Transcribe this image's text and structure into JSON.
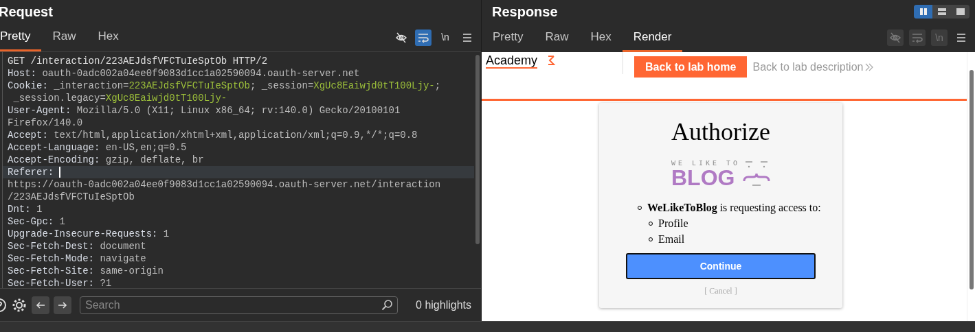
{
  "request": {
    "title": "Request",
    "tabs": [
      {
        "label": "Pretty",
        "selected": true
      },
      {
        "label": "Raw",
        "selected": false
      },
      {
        "label": "Hex",
        "selected": false
      }
    ],
    "toolbar": [
      {
        "kind": "eye",
        "active": false,
        "disabled": false
      },
      {
        "kind": "wrap",
        "active": true,
        "disabled": false
      },
      {
        "kind": "newline",
        "label": "\\n",
        "active": false,
        "disabled": false
      },
      {
        "kind": "menu",
        "active": false,
        "disabled": false
      }
    ],
    "lines": [
      [
        {
          "kind": "plain",
          "text": "GET /interaction/223AEJdsfVFCTuIeSptOb HTTP/2"
        }
      ],
      [
        {
          "kind": "name",
          "text": "Host:"
        },
        {
          "kind": "value",
          "text": " oauth-0adc002a04ee0f9083d1cc1a02590094.oauth-server.net"
        }
      ],
      [
        {
          "kind": "name",
          "text": "Cookie:"
        },
        {
          "kind": "value",
          "text": " _interaction="
        },
        {
          "kind": "cookie",
          "text": "223AEJdsfVFCTuIeSptOb"
        },
        {
          "kind": "value",
          "text": "; _session="
        },
        {
          "kind": "cookie",
          "text": "XgUc8Eaiwjd0tT100Ljy-"
        },
        {
          "kind": "value",
          "text": ";"
        }
      ],
      [
        {
          "kind": "value",
          "text": " _session.legacy="
        },
        {
          "kind": "cookie",
          "text": "XgUc8Eaiwjd0tT100Ljy-"
        }
      ],
      [
        {
          "kind": "name",
          "text": "User-Agent:"
        },
        {
          "kind": "value",
          "text": " Mozilla/5.0 (X11; Linux x86_64; rv:140.0) Gecko/20100101"
        }
      ],
      [
        {
          "kind": "value",
          "text": "Firefox/140.0"
        }
      ],
      [
        {
          "kind": "name",
          "text": "Accept:"
        },
        {
          "kind": "value",
          "text": " text/html,application/xhtml+xml,application/xml;q=0.9,*/*;q=0.8"
        }
      ],
      [
        {
          "kind": "name",
          "text": "Accept-Language:"
        },
        {
          "kind": "value",
          "text": " en-US,en;q=0.5"
        }
      ],
      [
        {
          "kind": "name",
          "text": "Accept-Encoding:"
        },
        {
          "kind": "value",
          "text": " gzip, deflate, br"
        }
      ],
      [
        {
          "kind": "name",
          "text": "Referer:"
        },
        {
          "kind": "cursor"
        }
      ],
      [
        {
          "kind": "value",
          "text": "https://oauth-0adc002a04ee0f9083d1cc1a02590094.oauth-server.net/interaction"
        }
      ],
      [
        {
          "kind": "value",
          "text": "/223AEJdsfVFCTuIeSptOb"
        }
      ],
      [
        {
          "kind": "name",
          "text": "Dnt:"
        },
        {
          "kind": "value",
          "text": " 1"
        }
      ],
      [
        {
          "kind": "name",
          "text": "Sec-Gpc:"
        },
        {
          "kind": "value",
          "text": " 1"
        }
      ],
      [
        {
          "kind": "name",
          "text": "Upgrade-Insecure-Requests:"
        },
        {
          "kind": "value",
          "text": " 1"
        }
      ],
      [
        {
          "kind": "name",
          "text": "Sec-Fetch-Dest:"
        },
        {
          "kind": "value",
          "text": " document"
        }
      ],
      [
        {
          "kind": "name",
          "text": "Sec-Fetch-Mode:"
        },
        {
          "kind": "value",
          "text": " navigate"
        }
      ],
      [
        {
          "kind": "name",
          "text": "Sec-Fetch-Site:"
        },
        {
          "kind": "value",
          "text": " same-origin"
        }
      ],
      [
        {
          "kind": "name",
          "text": "Sec-Fetch-User:"
        },
        {
          "kind": "value",
          "text": " ?1"
        }
      ]
    ],
    "search": {
      "placeholder": "Search"
    },
    "highlights": "0 highlights"
  },
  "response": {
    "title": "Response",
    "layout_buttons": [
      {
        "kind": "columns",
        "selected": true
      },
      {
        "kind": "rows",
        "selected": false
      },
      {
        "kind": "single",
        "selected": false
      }
    ],
    "tabs": [
      {
        "label": "Pretty",
        "selected": false
      },
      {
        "label": "Raw",
        "selected": false
      },
      {
        "label": "Hex",
        "selected": false
      },
      {
        "label": "Render",
        "selected": true
      }
    ],
    "toolbar": [
      {
        "kind": "eye",
        "active": false,
        "disabled": true
      },
      {
        "kind": "wrap",
        "active": false,
        "disabled": true
      },
      {
        "kind": "newline",
        "label": "\\n",
        "active": false,
        "disabled": true
      },
      {
        "kind": "menu",
        "active": false,
        "disabled": false
      }
    ],
    "render": {
      "logo_text": "Academy",
      "home_button": "Back to lab home",
      "description_link": "Back to lab description",
      "card": {
        "title": "Authorize",
        "logo_small": "WE LIKE TO",
        "logo_big": "BLOG",
        "request_text": "**WeLikeToBlog** is requesting access to:",
        "scopes": [
          "Profile",
          "Email"
        ],
        "continue": "Continue",
        "cancel": "[ Cancel ]"
      }
    }
  }
}
